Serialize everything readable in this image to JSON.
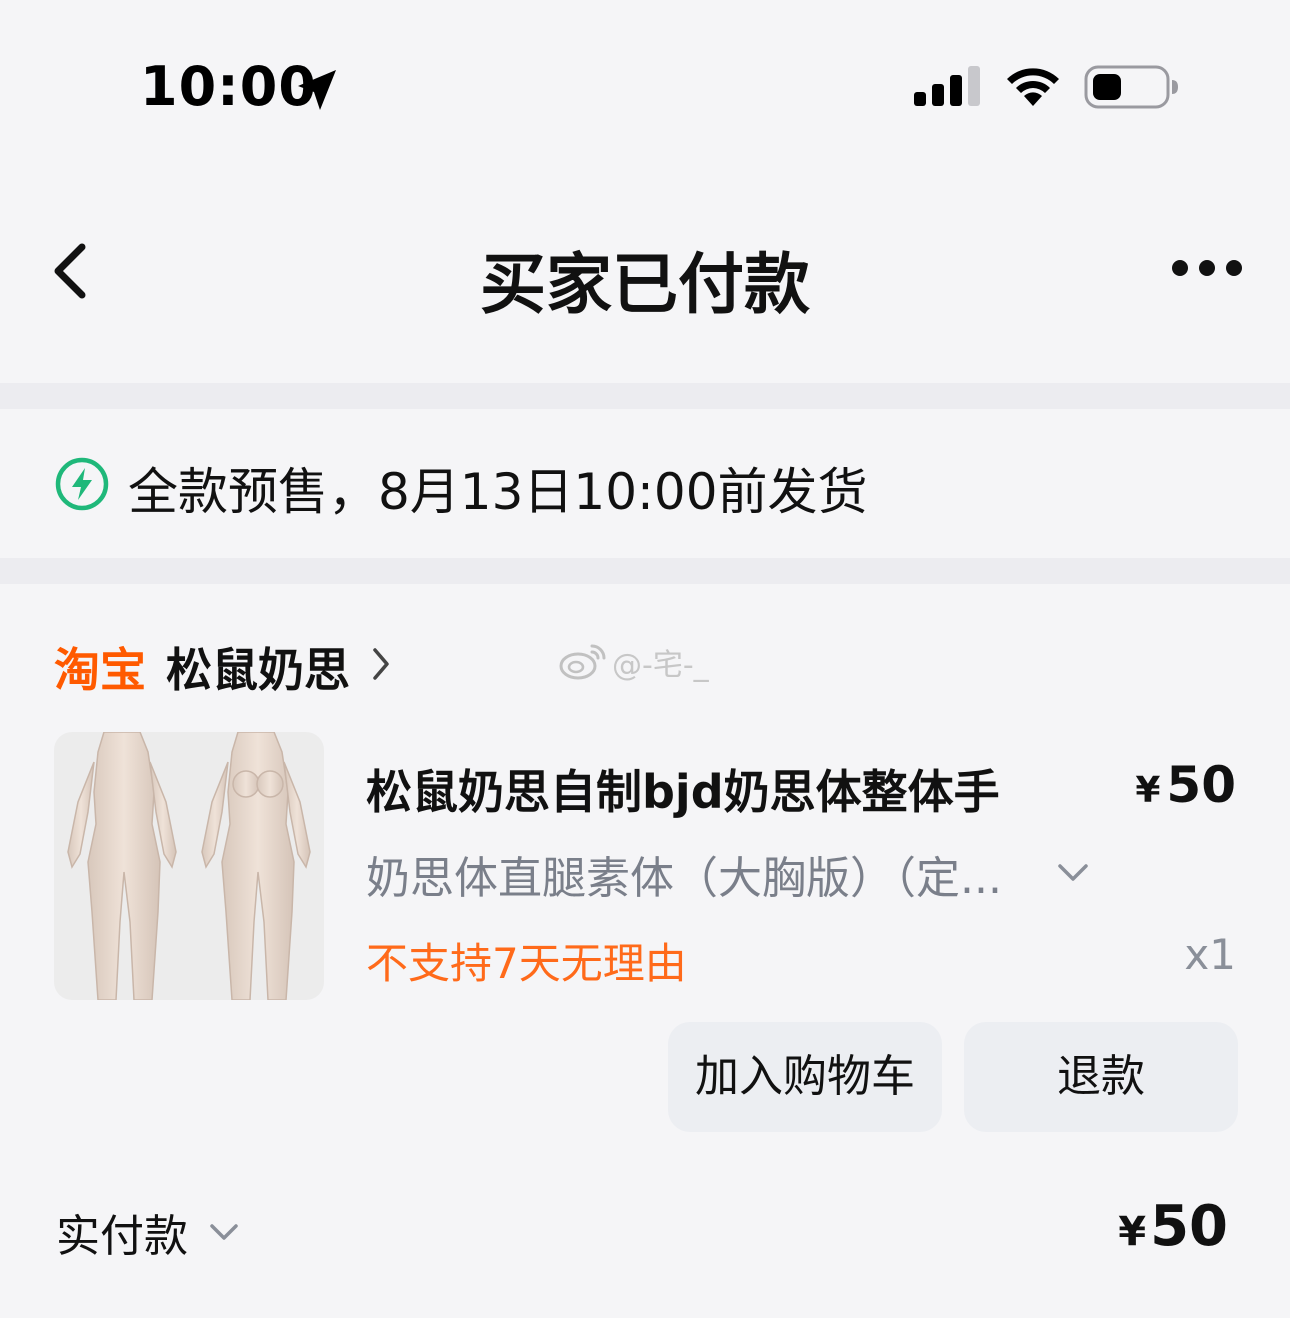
{
  "status_bar": {
    "time": "10:00",
    "icons": [
      "location-arrow-icon",
      "cellular-signal-icon",
      "wifi-icon",
      "battery-icon"
    ]
  },
  "nav": {
    "back_icon": "back-chevron-icon",
    "title": "买家已付款",
    "more_icon": "more-dots-icon"
  },
  "notice": {
    "icon": "lightning-bolt-icon",
    "text": "全款预售，8月13日10:00前发货",
    "icon_color": "#1fb87a"
  },
  "shop": {
    "platform_logo": "淘宝",
    "name": "松鼠奶思",
    "brand_color": "#ff5a00"
  },
  "watermark": {
    "text": "@-宅-_"
  },
  "product": {
    "title": "松鼠奶思自制bjd奶思体整体手",
    "price_currency": "¥",
    "price_value": "50",
    "sku": "奶思体直腿素体（大胸版）（定...",
    "policy": "不支持7天无理由",
    "policy_color": "#ff6a1a",
    "quantity": "x1"
  },
  "actions": {
    "add_to_cart": "加入购物车",
    "refund": "退款"
  },
  "payment": {
    "label": "实付款",
    "currency": "¥",
    "amount": "50"
  }
}
